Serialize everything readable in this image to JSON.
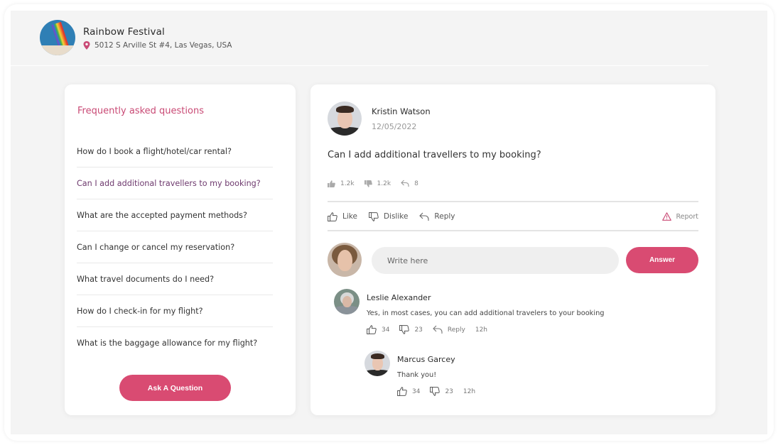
{
  "header": {
    "event_title": "Rainbow Festival",
    "event_location": "5012 S Arville St #4, Las Vegas, USA",
    "location_icon": "map-pin-icon"
  },
  "faq": {
    "title": "Frequently asked questions",
    "items": [
      {
        "label": "How do I book a flight/hotel/car rental?",
        "active": false
      },
      {
        "label": "Can I add additional travellers to my booking?",
        "active": true
      },
      {
        "label": "What are the accepted payment methods?",
        "active": false
      },
      {
        "label": "Can I change or cancel my reservation?",
        "active": false
      },
      {
        "label": "What travel documents do I need?",
        "active": false
      },
      {
        "label": "How do I check-in for my flight?",
        "active": false
      },
      {
        "label": "What is the baggage allowance for my flight?",
        "active": false
      }
    ],
    "ask_button_label": "Ask A Question"
  },
  "post": {
    "author_name": "Kristin Watson",
    "date": "12/05/2022",
    "question": "Can I add additional travellers to my booking?",
    "stats": {
      "likes": "1.2k",
      "dislikes": "1.2k",
      "replies": "8"
    },
    "actions": {
      "like": "Like",
      "dislike": "Dislike",
      "reply": "Reply",
      "report": "Report"
    },
    "answer_input": {
      "placeholder": "Write here",
      "value": ""
    },
    "answer_button_label": "Answer"
  },
  "comments": [
    {
      "author": "Leslie Alexander",
      "text": "Yes, in most cases, you can add additional travelers to your booking",
      "likes": "34",
      "dislikes": "23",
      "reply_label": "Reply",
      "time": "12h"
    },
    {
      "author": "Marcus Garcey",
      "text": "Thank you!",
      "likes": "34",
      "dislikes": "23",
      "time": "12h"
    }
  ],
  "colors": {
    "accent": "#d94b72",
    "faq_title": "#c94a75",
    "active_faq": "#6e3a6e",
    "background": "#f4f4f4",
    "card": "#ffffff"
  }
}
